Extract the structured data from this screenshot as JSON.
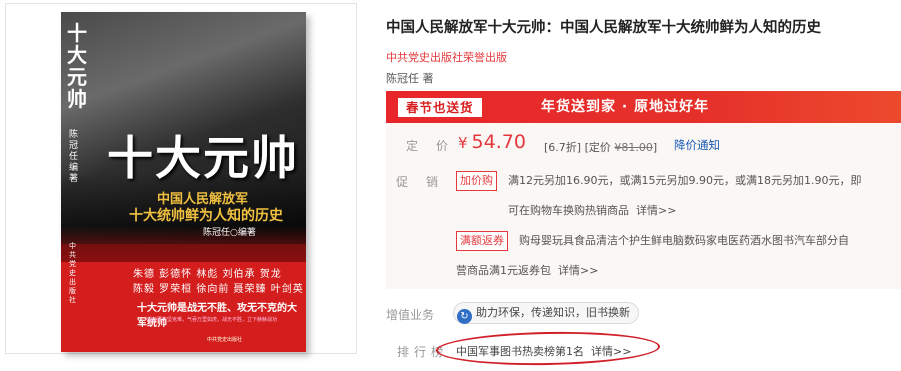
{
  "cover": {
    "spine_title": "十大元帅",
    "spine_subtitle": "中国人民解放军十大统帅鲜为人知的历史",
    "spine_author": "陈冠任 编著",
    "spine_publisher": "中共党史出版社",
    "big_title": "十大元帅",
    "subtitle_line1": "中国人民解放军",
    "subtitle_line2": "十大统帅鲜为人知的历史",
    "author": "陈冠任○编著",
    "names_line1": "朱德 彭德怀 林彪 刘伯承 贺龙",
    "names_line2": "陈毅 罗荣桓 徐向前 聂荣臻 叶剑英",
    "slogan": "十大元帅是战无不胜、攻无不克的大军统帅",
    "small_text": "解放军攻坚克难，气吞万里如虎，战无不胜，立下赫赫战功",
    "publisher": "中共党史出版社"
  },
  "product": {
    "title": "中国人民解放军十大元帅：中国人民解放军十大统帅鲜为人知的历史",
    "publisher": "中共党史出版社荣誉出版",
    "author": "陈冠任 著"
  },
  "banner": {
    "tag": "春节也送货",
    "text": "年货送到家 · 原地过好年"
  },
  "price": {
    "label": [
      "定",
      "价"
    ],
    "currency": "¥",
    "value": "54.70",
    "discount_prefix": "[6.7折] [定价 ",
    "original": "¥81.00",
    "discount_suffix": "]",
    "notify": "降价通知"
  },
  "promotion": {
    "label": [
      "促",
      "销"
    ],
    "items": [
      {
        "tag": "加价购",
        "line1": "满12元另加16.90元，或满15元另加9.90元，或满18元另加1.90元，即",
        "line2": "可在购物车换购热销商品",
        "more": "详情>>"
      },
      {
        "tag": "满额返券",
        "line1": "购母婴玩具食品清洁个护生鲜电脑数码家电医药酒水图书汽车部分自",
        "line2": "营商品满1元返券包",
        "more": "详情>>"
      }
    ]
  },
  "service": {
    "label": "增值业务",
    "chip": "助力环保，传递知识，旧书换新"
  },
  "ranking": {
    "label": [
      "排",
      "行",
      "榜"
    ],
    "text": "中国军事图书热卖榜第1名",
    "more": "详情>>"
  },
  "colors": {
    "accent_red": "#e4393c",
    "banner_red": "#e8262a",
    "link_blue": "#1a5ab4",
    "highlight_circle": "#d0202a"
  }
}
